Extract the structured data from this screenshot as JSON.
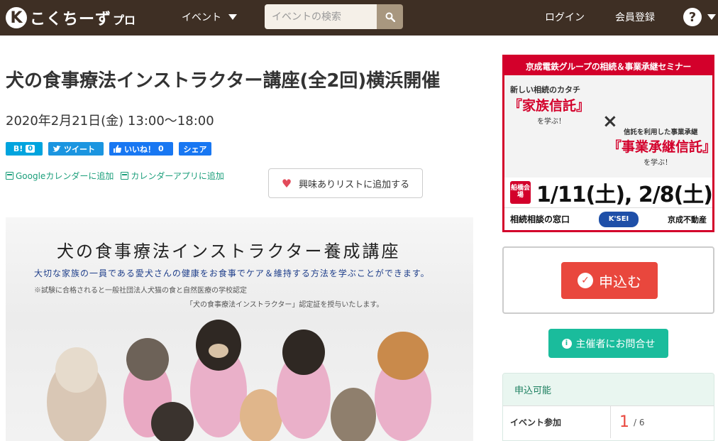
{
  "header": {
    "logo_mark": "K",
    "logo_text": "こくちーず",
    "logo_sub": "プロ",
    "nav_event": "イベント",
    "search_placeholder": "イベントの検索",
    "login": "ログイン",
    "register": "会員登録",
    "help": "?"
  },
  "event": {
    "title": "犬の食事療法インストラクター講座(全2回)横浜開催",
    "datetime": "2020年2月21日(金) 13:00〜18:00",
    "share": {
      "hatena_label": "B!",
      "hatena_count": "0",
      "tweet_label": "ツイート",
      "like_label": "いいね！",
      "like_count": "0",
      "share_label": "シェア"
    },
    "calendar": {
      "google": "Googleカレンダーに追加",
      "app": "カレンダーアプリに追加"
    },
    "favorite_button": "興味ありリストに追加する",
    "banner": {
      "title": "犬の食事療法インストラクター養成講座",
      "subtitle": "大切な家族の一員である愛犬さんの健康をお食事でケア＆維持する方法を学ぶことができます。",
      "note1": "※試験に合格されると一般社団法人犬猫の食と自然医療の学校認定",
      "note2": "「犬の食事療法インストラクター」認定証を授与いたします。"
    }
  },
  "ad": {
    "header": "京成電鉄グループの相続＆事業承継セミナー",
    "left_top": "新しい相続のカタチ",
    "left_main": "『家族信託』",
    "left_bottom": "を学ぶ！",
    "cross": "×",
    "right_top": "信託を利用した事業承継",
    "right_main": "『事業承継信託』",
    "right_bottom": "を学ぶ！",
    "venue": "船橋会場",
    "dates": "1/11(土), 2/8(土)",
    "footer_left": "相続相談の窓口",
    "footer_logo": "K'SEI",
    "footer_right": "京成不動産"
  },
  "sidebar": {
    "apply_button": "申込む",
    "contact_button": "主催者にお問合せ",
    "status_label": "申込可能",
    "participation_label": "イベント参加",
    "participation_count": "1",
    "participation_total": "/ 6"
  },
  "colors": {
    "header_bg": "#3e2f24",
    "apply_red": "#e9473d",
    "contact_green": "#1abc9c",
    "ad_red": "#d3002b"
  }
}
